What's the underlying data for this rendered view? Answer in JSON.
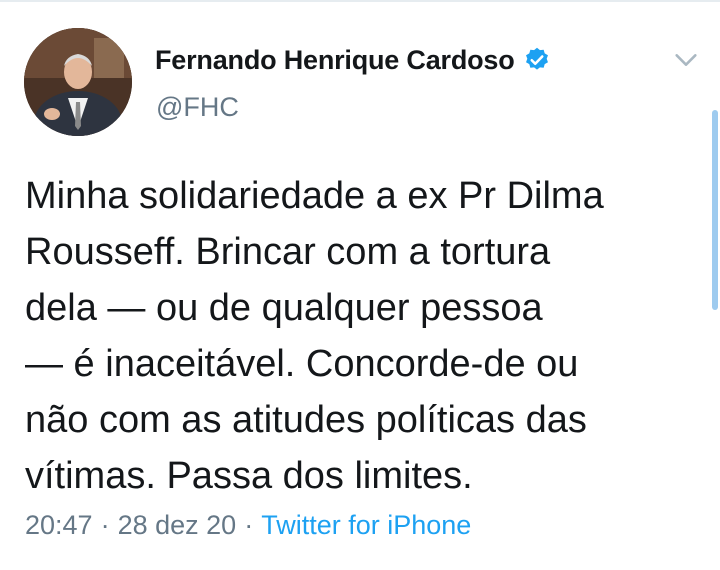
{
  "author": {
    "display_name": "Fernando Henrique Cardoso",
    "handle": "@FHC",
    "verified_icon": "verified-badge-icon",
    "verified_color": "#1da1f2"
  },
  "tweet": {
    "lines": [
      "Minha solidariedade a ex Pr Dilma",
      "Rousseff. Brincar com a tortura",
      "dela — ou de qualquer pessoa",
      "— é inaceitável. Concorde-de ou",
      "não com as atitudes políticas das",
      "vítimas. Passa dos limites."
    ]
  },
  "meta": {
    "time": "20:47",
    "separator": "·",
    "date": "28 dez 20",
    "source": "Twitter for iPhone",
    "source_color": "#1da1f2"
  },
  "icons": {
    "menu_caret": "chevron-down-icon"
  }
}
